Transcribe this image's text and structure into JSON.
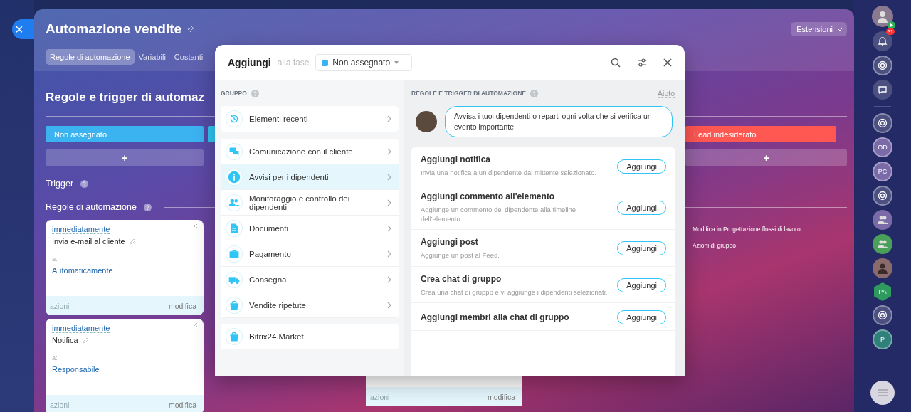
{
  "close_button": {
    "label": "×"
  },
  "page": {
    "title": "Automazione vendite",
    "extensions_button": "Estensioni",
    "tabs": [
      {
        "label": "Regole di automazione",
        "selected": true
      },
      {
        "label": "Variabili",
        "selected": false
      },
      {
        "label": "Costanti",
        "selected": false
      }
    ],
    "heading": "Regole e trigger di automaz",
    "stages": [
      {
        "label": "Non assegnato",
        "color": "#3bb3f0"
      },
      {
        "color": "#2fc6f6"
      },
      {
        "label": "Lead indesiderato",
        "color": "#ff5752"
      }
    ],
    "add_label": "+",
    "trigger_label": "Trigger",
    "rules_label": "Regole di automazione",
    "rule_cards": [
      {
        "timing": "immediatamente",
        "title": "Invia e-mail al cliente",
        "to_label": "a:",
        "to": "Automaticamente",
        "actions": "azioni",
        "edit": "modifica"
      },
      {
        "timing": "immediatamente",
        "title": "Notifica",
        "to_label": "a:",
        "to": "Responsabile",
        "actions": "azioni",
        "edit": "modifica"
      }
    ],
    "middle_card": {
      "actions": "azioni",
      "edit": "modifica"
    },
    "right_links": [
      "Modifica in Progettazione flussi di lavoro",
      "Azioni di gruppo"
    ]
  },
  "dialog": {
    "title": "Aggiungi",
    "stage_prefix": "alla fase",
    "stage": {
      "label": "Non assegnato",
      "color": "#3bb3f0"
    },
    "group_heading": "GRUPPO",
    "recent": {
      "label": "Elementi recenti"
    },
    "groups": [
      {
        "label": "Comunicazione con il cliente",
        "selected": false
      },
      {
        "label": "Avvisi per i dipendenti",
        "selected": true
      },
      {
        "label": "Monitoraggio e controllo dei dipendenti",
        "selected": false
      },
      {
        "label": "Documenti",
        "selected": false
      },
      {
        "label": "Pagamento",
        "selected": false
      },
      {
        "label": "Consegna",
        "selected": false
      },
      {
        "label": "Vendite ripetute",
        "selected": false
      }
    ],
    "market": {
      "label": "Bitrix24.Market"
    },
    "rules_heading": "REGOLE E TRIGGER DI AUTOMAZIONE",
    "help_link": "Aiuto",
    "tip": "Avvisa i tuoi dipendenti o reparti ogni volta che si verifica un evento importante",
    "actions": [
      {
        "title": "Aggiungi notifica",
        "description": "Invia una notifica a un dipendente dal mittente selezionato.",
        "button": "Aggiungi"
      },
      {
        "title": "Aggiungi commento all'elemento",
        "description": "Aggiunge un commento del dipendente alla timeline dell'elemento.",
        "button": "Aggiungi"
      },
      {
        "title": "Aggiungi post",
        "description": "Aggiunge un post al Feed.",
        "button": "Aggiungi"
      },
      {
        "title": "Crea chat di gruppo",
        "description": "Crea una chat di gruppo e vi aggiunge i dipendenti selezionati.",
        "button": "Aggiungi"
      },
      {
        "title": "Aggiungi membri alla chat di gruppo",
        "button": "Aggiungi"
      }
    ]
  },
  "right_bar": {
    "items": [
      {
        "kind": "user"
      },
      {
        "kind": "bell",
        "badge": "31"
      },
      {
        "kind": "target"
      },
      {
        "kind": "chat"
      },
      {
        "kind": "divider"
      },
      {
        "kind": "target"
      },
      {
        "kind": "initials",
        "text": "OD",
        "color": "#7a6aa8"
      },
      {
        "kind": "initials",
        "text": "PC",
        "color": "#7a6aa8"
      },
      {
        "kind": "target"
      },
      {
        "kind": "group",
        "color": "#7a6aa8"
      },
      {
        "kind": "group",
        "color": "#4aa05a"
      },
      {
        "kind": "person"
      },
      {
        "kind": "hex",
        "text": "PA",
        "color": "#2e9a5e"
      },
      {
        "kind": "target"
      },
      {
        "kind": "initials",
        "text": "P",
        "color": "#2f7f7a"
      }
    ]
  }
}
